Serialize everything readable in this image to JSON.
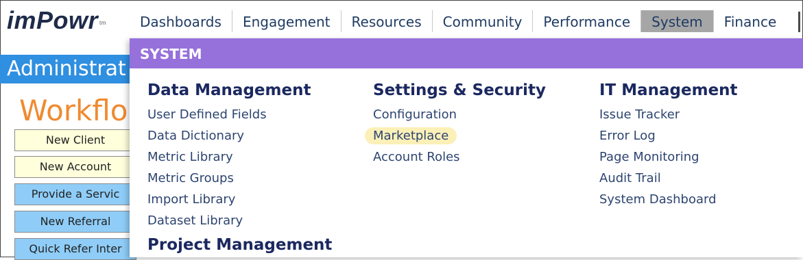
{
  "logo": {
    "text": "imPowr",
    "tm": "tm"
  },
  "topnav": {
    "items": [
      {
        "label": "Dashboards"
      },
      {
        "label": "Engagement"
      },
      {
        "label": "Resources"
      },
      {
        "label": "Community"
      },
      {
        "label": "Performance"
      },
      {
        "label": "System"
      },
      {
        "label": "Finance"
      }
    ],
    "active": "System"
  },
  "page": {
    "admin_title": "Administrat",
    "workflow_title": "Workflo",
    "buttons": [
      {
        "label": "New Client",
        "color": "yellow"
      },
      {
        "label": "New Account",
        "color": "yellow"
      },
      {
        "label": "Provide a Servic",
        "color": "blue"
      },
      {
        "label": "New Referral",
        "color": "blue"
      },
      {
        "label": "Quick Refer Inter",
        "color": "blue"
      }
    ]
  },
  "menu": {
    "header": "SYSTEM",
    "columns": [
      {
        "title": "Data Management",
        "items": [
          "User Defined Fields",
          "Data Dictionary",
          "Metric Library",
          "Metric Groups",
          "Import Library",
          "Dataset Library"
        ],
        "second_title": "Project Management"
      },
      {
        "title": "Settings & Security",
        "items": [
          "Configuration",
          "Marketplace",
          "Account Roles"
        ],
        "highlighted": "Marketplace"
      },
      {
        "title": "IT Management",
        "items": [
          "Issue Tracker",
          "Error Log",
          "Page Monitoring",
          "Audit Trail",
          "System Dashboard"
        ]
      }
    ]
  },
  "colors": {
    "menu_header_bg": "#9671db",
    "admin_bar_bg": "#2f8fe0",
    "workflow_title": "#f08a30",
    "active_nav_bg": "#a6a6a6",
    "highlight_bg": "#fbf0b8"
  }
}
